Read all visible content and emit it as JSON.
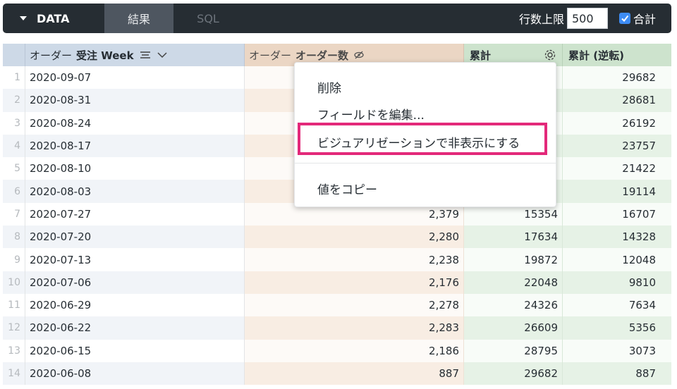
{
  "toolbar": {
    "data_label": "DATA",
    "tabs": [
      {
        "label": "結果",
        "active": true
      },
      {
        "label": "SQL",
        "active": false
      }
    ],
    "row_limit_label": "行数上限",
    "row_limit_value": "500",
    "totals_label": "合計",
    "totals_checked": true
  },
  "table": {
    "headers": {
      "dim_prefix": "オーダー",
      "dim_name": "受注 Week",
      "meas_prefix": "オーダー",
      "meas_name": "オーダー数",
      "calc1": "累計",
      "calc2": "累計 (逆転)"
    },
    "rows": [
      {
        "idx": "1",
        "week": "2020-09-07",
        "count": "",
        "cum": "",
        "rev": "29682"
      },
      {
        "idx": "2",
        "week": "2020-08-31",
        "count": "",
        "cum": "",
        "rev": "28681"
      },
      {
        "idx": "3",
        "week": "2020-08-24",
        "count": "",
        "cum": "",
        "rev": "26192"
      },
      {
        "idx": "4",
        "week": "2020-08-17",
        "count": "",
        "cum": "",
        "rev": "23757"
      },
      {
        "idx": "5",
        "week": "2020-08-10",
        "count": "",
        "cum": "",
        "rev": "21422"
      },
      {
        "idx": "6",
        "week": "2020-08-03",
        "count": "",
        "cum": "",
        "rev": "19114"
      },
      {
        "idx": "7",
        "week": "2020-07-27",
        "count": "2,379",
        "cum": "15354",
        "rev": "16707"
      },
      {
        "idx": "8",
        "week": "2020-07-20",
        "count": "2,280",
        "cum": "17634",
        "rev": "14328"
      },
      {
        "idx": "9",
        "week": "2020-07-13",
        "count": "2,238",
        "cum": "19872",
        "rev": "12048"
      },
      {
        "idx": "10",
        "week": "2020-07-06",
        "count": "2,176",
        "cum": "22048",
        "rev": "9810"
      },
      {
        "idx": "11",
        "week": "2020-06-29",
        "count": "2,278",
        "cum": "24326",
        "rev": "7634"
      },
      {
        "idx": "12",
        "week": "2020-06-22",
        "count": "2,283",
        "cum": "26609",
        "rev": "5356"
      },
      {
        "idx": "13",
        "week": "2020-06-15",
        "count": "2,186",
        "cum": "28795",
        "rev": "3073"
      },
      {
        "idx": "14",
        "week": "2020-06-08",
        "count": "887",
        "cum": "29682",
        "rev": "887"
      }
    ]
  },
  "context_menu": {
    "items": [
      {
        "label": "削除"
      },
      {
        "label": "フィールドを編集..."
      },
      {
        "label": "ビジュアリゼーションで非表示にする",
        "highlighted": true
      },
      {
        "label": "値をコピー"
      }
    ]
  },
  "colors": {
    "toolbar_bg": "#262d33",
    "dimension_header": "#cdd9e7",
    "measure_header": "#ebd6c4",
    "calc_header": "#cde3cd",
    "highlight_border": "#e3297a",
    "checkbox": "#3d8cf5"
  }
}
